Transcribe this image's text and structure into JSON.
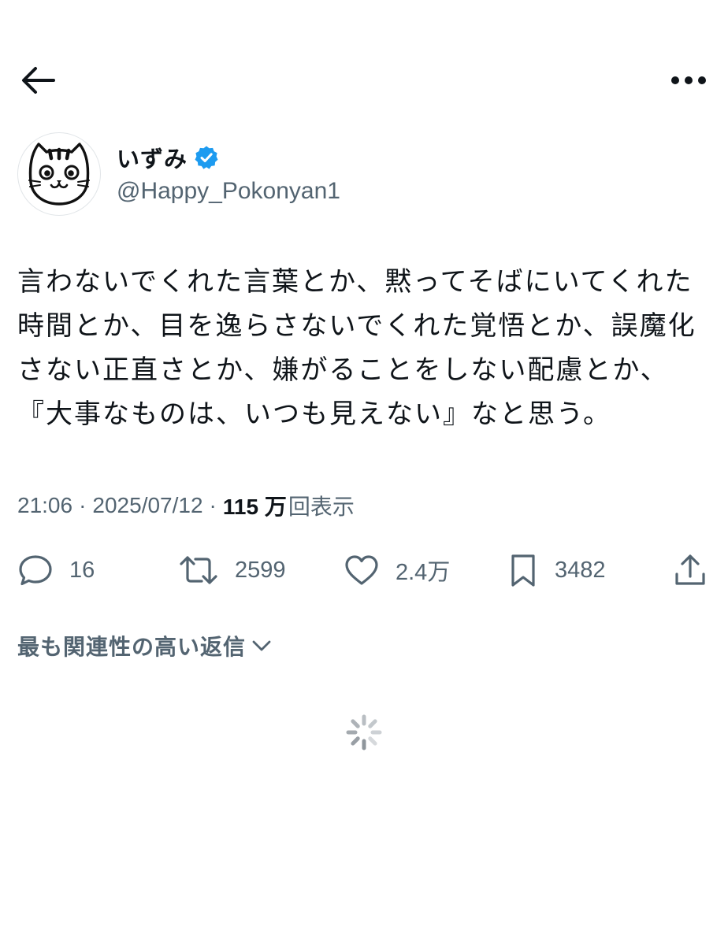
{
  "header": {
    "back_icon": "arrow-left-icon",
    "more_icon": "more-horizontal-icon"
  },
  "author": {
    "name": "いずみ",
    "handle": "@Happy_Pokonyan1",
    "verified": true,
    "verified_color": "#1d9bf0",
    "avatar_icon": "cat-face-avatar"
  },
  "tweet": {
    "text": "言わないでくれた言葉とか、黙ってそばにいてくれた時間とか、目を逸らさないでくれた覚悟とか、誤魔化さない正直さとか、嫌がることをしない配慮とか、『大事なものは、いつも見えない』なと思う。"
  },
  "meta": {
    "time": "21:06",
    "date": "2025/07/12",
    "views_count": "115 万",
    "views_label": "回表示",
    "separator": "·"
  },
  "actions": {
    "replies": "16",
    "reposts": "2599",
    "likes": "2.4万",
    "bookmarks": "3482"
  },
  "replies_sort": {
    "label": "最も関連性の高い返信"
  },
  "colors": {
    "text": "#0f1419",
    "muted": "#536471",
    "accent": "#1d9bf0"
  }
}
